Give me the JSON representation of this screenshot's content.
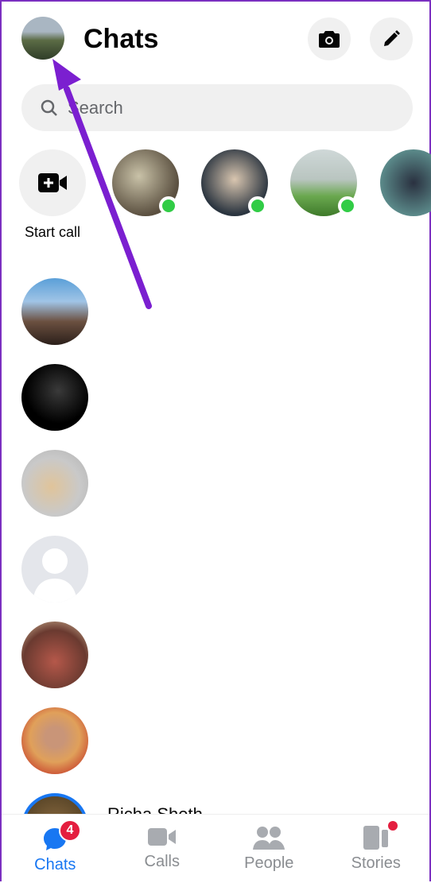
{
  "header": {
    "title": "Chats",
    "camera_icon": "camera-icon",
    "compose_icon": "pencil-icon"
  },
  "search": {
    "placeholder": "Search"
  },
  "stories": {
    "start_call_label": "Start call"
  },
  "chats": [
    {
      "name": ""
    },
    {
      "name": ""
    },
    {
      "name": ""
    },
    {
      "name": ""
    },
    {
      "name": ""
    },
    {
      "name": ""
    },
    {
      "name": "Richa Sheth"
    }
  ],
  "nav": {
    "tabs": [
      {
        "label": "Chats",
        "badge": "4"
      },
      {
        "label": "Calls"
      },
      {
        "label": "People"
      },
      {
        "label": "Stories"
      }
    ]
  },
  "colors": {
    "accent": "#1877f2",
    "online": "#31cc46",
    "annotation_arrow": "#7b1fd0",
    "badge": "#e41e3f"
  }
}
